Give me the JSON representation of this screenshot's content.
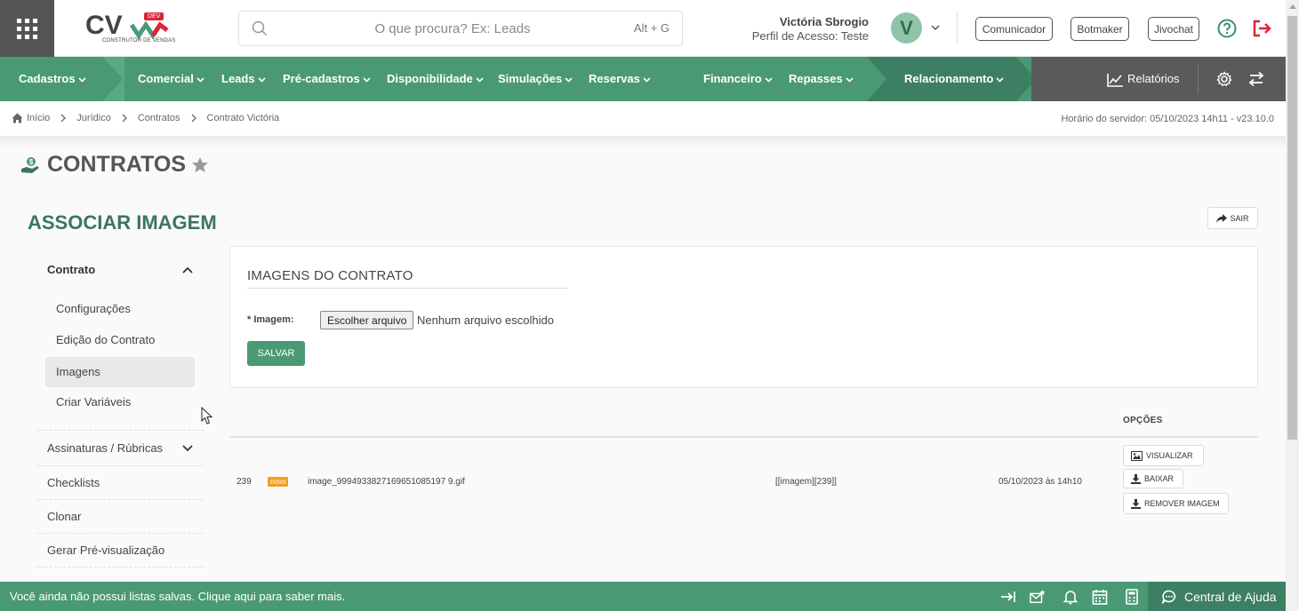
{
  "header": {
    "logo_text": "CV",
    "logo_badge": "DEV",
    "logo_subtitle": "CONSTRUTOR DE VENDAS",
    "search": {
      "placeholder": "O que procura? Ex: Leads",
      "shortcut": "Alt + G"
    },
    "user": {
      "name": "Victória Sbrogio",
      "profile": "Perfil de Acesso: Teste",
      "initial": "V"
    },
    "buttons": {
      "communicator": "Comunicador",
      "botmaker": "Botmaker",
      "jivochat": "Jivochat"
    }
  },
  "nav": {
    "items": [
      {
        "label": "Cadastros"
      },
      {
        "label": "Comercial"
      },
      {
        "label": "Leads"
      },
      {
        "label": "Pré-cadastros"
      },
      {
        "label": "Disponibilidade"
      },
      {
        "label": "Simulações"
      },
      {
        "label": "Reservas"
      },
      {
        "label": "Financeiro"
      },
      {
        "label": "Repasses"
      },
      {
        "label": "Relacionamento"
      }
    ],
    "reports": "Relatórios"
  },
  "breadcrumb": [
    "Início",
    "Jurídico",
    "Contratos",
    "Contrato Victória"
  ],
  "server_time": "Horário do servidor: 05/10/2023 14h11 - v23.10.0",
  "page": {
    "title": "CONTRATOS",
    "section_title": "ASSOCIAR IMAGEM",
    "exit_label": "SAIR"
  },
  "side_menu": {
    "group": "Contrato",
    "sub_items": [
      "Configurações",
      "Edição do Contrato",
      "Imagens",
      "Criar Variáveis"
    ],
    "items": [
      "Assinaturas / Rúbricas",
      "Checklists",
      "Clonar",
      "Gerar Pré-visualização"
    ]
  },
  "form": {
    "card_title": "IMAGENS DO CONTRATO",
    "image_label": "* Imagem:",
    "file_button": "Escolher arquivo",
    "file_status": "Nenhum arquivo escolhido",
    "save_label": "SALVAR"
  },
  "table": {
    "options_header": "OPÇÕES",
    "rows": [
      {
        "id": "239",
        "badge": "novo",
        "filename": "image_9994933827169651085197 9.gif",
        "tag": "[[imagem][239]]",
        "date": "05/10/2023 às 14h10",
        "actions": {
          "view": "VISUALIZAR",
          "download": "BAIXAR",
          "remove": "REMOVER IMAGEM"
        }
      }
    ]
  },
  "footer": {
    "message": "Você ainda não possui listas salvas. Clique aqui para saber mais.",
    "help_center": "Central de Ajuda"
  },
  "colors": {
    "primary": "#4a9975",
    "dark_green": "#3b7560",
    "nav_gray": "#5a5a5a",
    "logout_red": "#d9263b"
  }
}
